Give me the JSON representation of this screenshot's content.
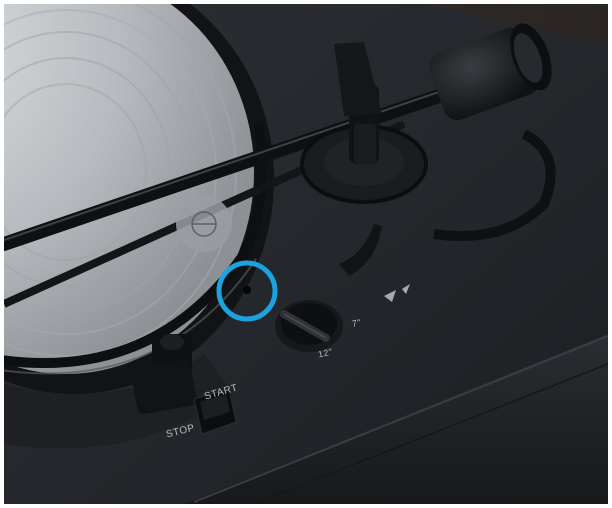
{
  "photo": {
    "subject": "turntable-closeup",
    "labels": {
      "start": "START",
      "stop": "STOP",
      "size_7": "7\"",
      "size_12": "12\""
    },
    "highlight": {
      "shape": "circle",
      "color": "#1aa3e0"
    },
    "colors": {
      "plinth": "#26292d",
      "platter_record": "#c9cdd1",
      "frame": "#ffffff"
    }
  }
}
